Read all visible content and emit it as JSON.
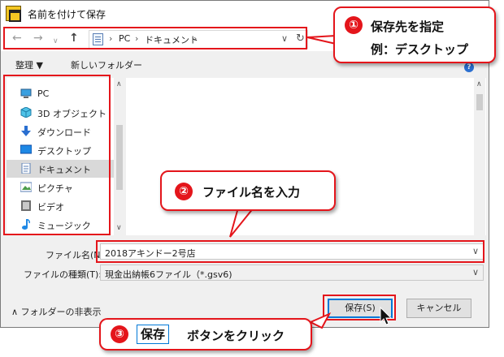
{
  "window": {
    "title": "名前を付けて保存"
  },
  "address_bar": {
    "segments": [
      "PC",
      "ドキュメント"
    ]
  },
  "toolbar": {
    "organize": "整理 ▼",
    "new_folder": "新しいフォルダー"
  },
  "nav_pane": {
    "items": [
      {
        "label": "PC",
        "icon": "pc-icon"
      },
      {
        "label": "3D オブジェクト",
        "icon": "3d-objects-icon"
      },
      {
        "label": "ダウンロード",
        "icon": "download-icon"
      },
      {
        "label": "デスクトップ",
        "icon": "desktop-icon"
      },
      {
        "label": "ドキュメント",
        "icon": "documents-icon",
        "selected": true
      },
      {
        "label": "ピクチャ",
        "icon": "pictures-icon"
      },
      {
        "label": "ビデオ",
        "icon": "videos-icon"
      },
      {
        "label": "ミュージック",
        "icon": "music-icon"
      }
    ]
  },
  "form": {
    "filename_label": "ファイル名(N):",
    "filename_value": "2018アキンドー2号店",
    "filetype_label": "ファイルの種類(T):",
    "filetype_value": "現金出納帳6ファイル（*.gsv6)"
  },
  "footer": {
    "hide_folders": "フォルダーの非表示",
    "save": "保存(S)",
    "cancel": "キャンセル"
  },
  "callouts": {
    "c1": {
      "number": "①",
      "line1": "保存先を指定",
      "line2": "例：デスクトップ"
    },
    "c2": {
      "number": "②",
      "text": "ファイル名を入力"
    },
    "c3": {
      "number": "③",
      "chip": "保存",
      "text": "ボタンをクリック"
    }
  },
  "colors": {
    "annotation_red": "#e4151b",
    "accent_blue": "#0078d7"
  }
}
